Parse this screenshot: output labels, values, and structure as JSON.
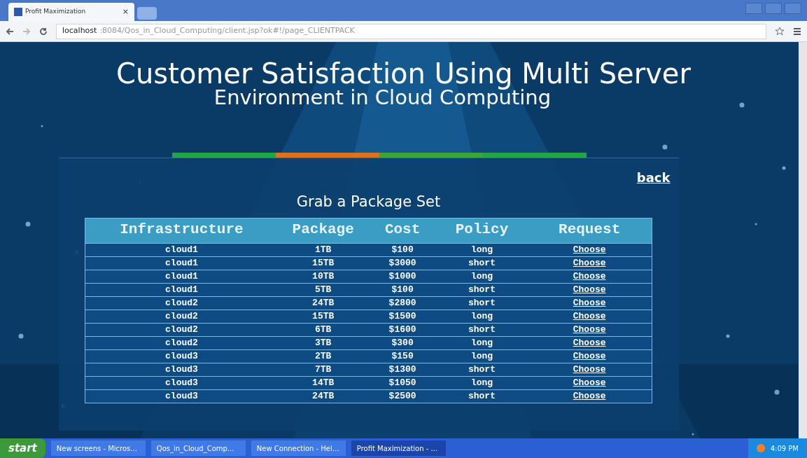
{
  "browser": {
    "tab_title": "Profit Maximization",
    "tab_close": "×",
    "url_host": "localhost",
    "url_rest": ":8084/Qos_in_Cloud_Computing/client.jsp?ok#!/page_CLIENTPACK"
  },
  "page": {
    "title_line_1": "Customer Satisfaction Using Multi Server",
    "title_line_2": "Environment in Cloud Computing",
    "segments": [
      {
        "color": "#1fa54a"
      },
      {
        "color": "#d9731f"
      },
      {
        "color": "#3aa53a"
      },
      {
        "color": "#1fa54a"
      }
    ],
    "back_link": "back",
    "heading": "Grab a Package Set",
    "table": {
      "columns": [
        "Infrastructure",
        "Package",
        "Cost",
        "Policy",
        "Request"
      ],
      "rows": [
        [
          "cloud1",
          "1TB",
          "$100",
          "long",
          "Choose"
        ],
        [
          "cloud1",
          "15TB",
          "$3000",
          "short",
          "Choose"
        ],
        [
          "cloud1",
          "10TB",
          "$1000",
          "long",
          "Choose"
        ],
        [
          "cloud1",
          "5TB",
          "$100",
          "short",
          "Choose"
        ],
        [
          "cloud2",
          "24TB",
          "$2800",
          "short",
          "Choose"
        ],
        [
          "cloud2",
          "15TB",
          "$1500",
          "long",
          "Choose"
        ],
        [
          "cloud2",
          "6TB",
          "$1600",
          "short",
          "Choose"
        ],
        [
          "cloud2",
          "3TB",
          "$300",
          "long",
          "Choose"
        ],
        [
          "cloud3",
          "2TB",
          "$150",
          "long",
          "Choose"
        ],
        [
          "cloud3",
          "7TB",
          "$1300",
          "short",
          "Choose"
        ],
        [
          "cloud3",
          "14TB",
          "$1050",
          "long",
          "Choose"
        ],
        [
          "cloud3",
          "24TB",
          "$2500",
          "short",
          "Choose"
        ]
      ]
    }
  },
  "taskbar": {
    "start": "start",
    "tasks": [
      {
        "label": "New screens - Micros...",
        "selected": false
      },
      {
        "label": "Qos_in_Cloud_Comp...",
        "selected": false
      },
      {
        "label": "New Connection - Hel...",
        "selected": false
      },
      {
        "label": "Profit Maximization - ...",
        "selected": true
      }
    ],
    "clock": "4:09 PM"
  }
}
